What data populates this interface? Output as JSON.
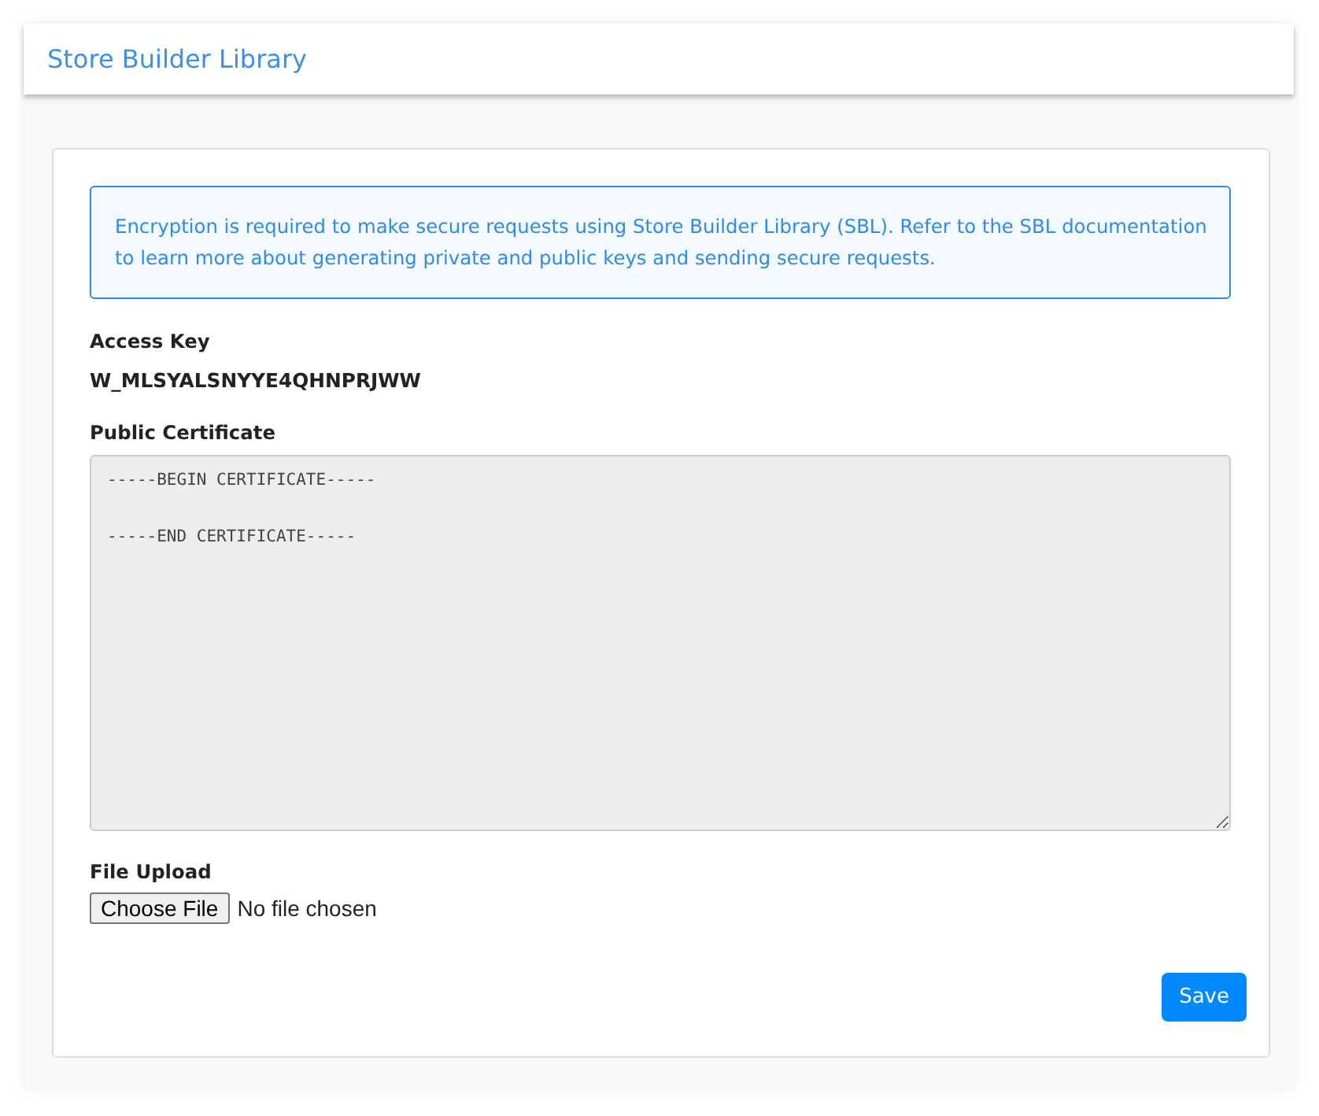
{
  "header": {
    "title": "Store Builder Library"
  },
  "notice": "Encryption is required to make secure requests using Store Builder Library (SBL). Refer to the SBL documentation to learn more about generating private and public keys and sending secure requests.",
  "access_key": {
    "label": "Access Key",
    "value": "W_MLSYALSNYYE4QHNPRJWW"
  },
  "certificate": {
    "label": "Public Certificate",
    "value": "-----BEGIN CERTIFICATE-----\n\n-----END CERTIFICATE-----",
    "disabled": true
  },
  "file_upload": {
    "label": "File Upload",
    "button": "Choose File",
    "status": "No file chosen"
  },
  "save_button": "Save"
}
